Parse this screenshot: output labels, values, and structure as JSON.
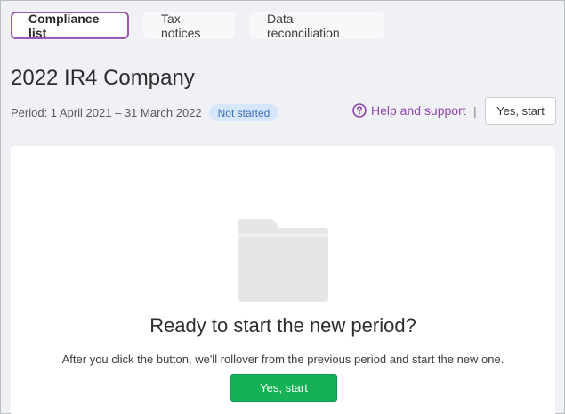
{
  "tabs": [
    {
      "label": "Compliance list",
      "active": true
    },
    {
      "label": "Tax notices",
      "active": false
    },
    {
      "label": "Data reconciliation",
      "active": false
    }
  ],
  "header": {
    "title": "2022 IR4 Company",
    "period": "Period: 1 April 2021 – 31 March 2022",
    "status_badge": "Not started",
    "help_label": "Help and support",
    "separator": "|",
    "start_label": "Yes, start"
  },
  "empty_state": {
    "icon": "folder-icon",
    "title": "Ready to start the new period?",
    "subtitle": "After you click the button, we'll rollover from the previous period and start the new one.",
    "button_label": "Yes, start"
  },
  "colors": {
    "accent": "#9b59b6",
    "primary_button": "#14b254",
    "badge_bg": "#d6e6fb",
    "badge_text": "#3a6fb5"
  }
}
